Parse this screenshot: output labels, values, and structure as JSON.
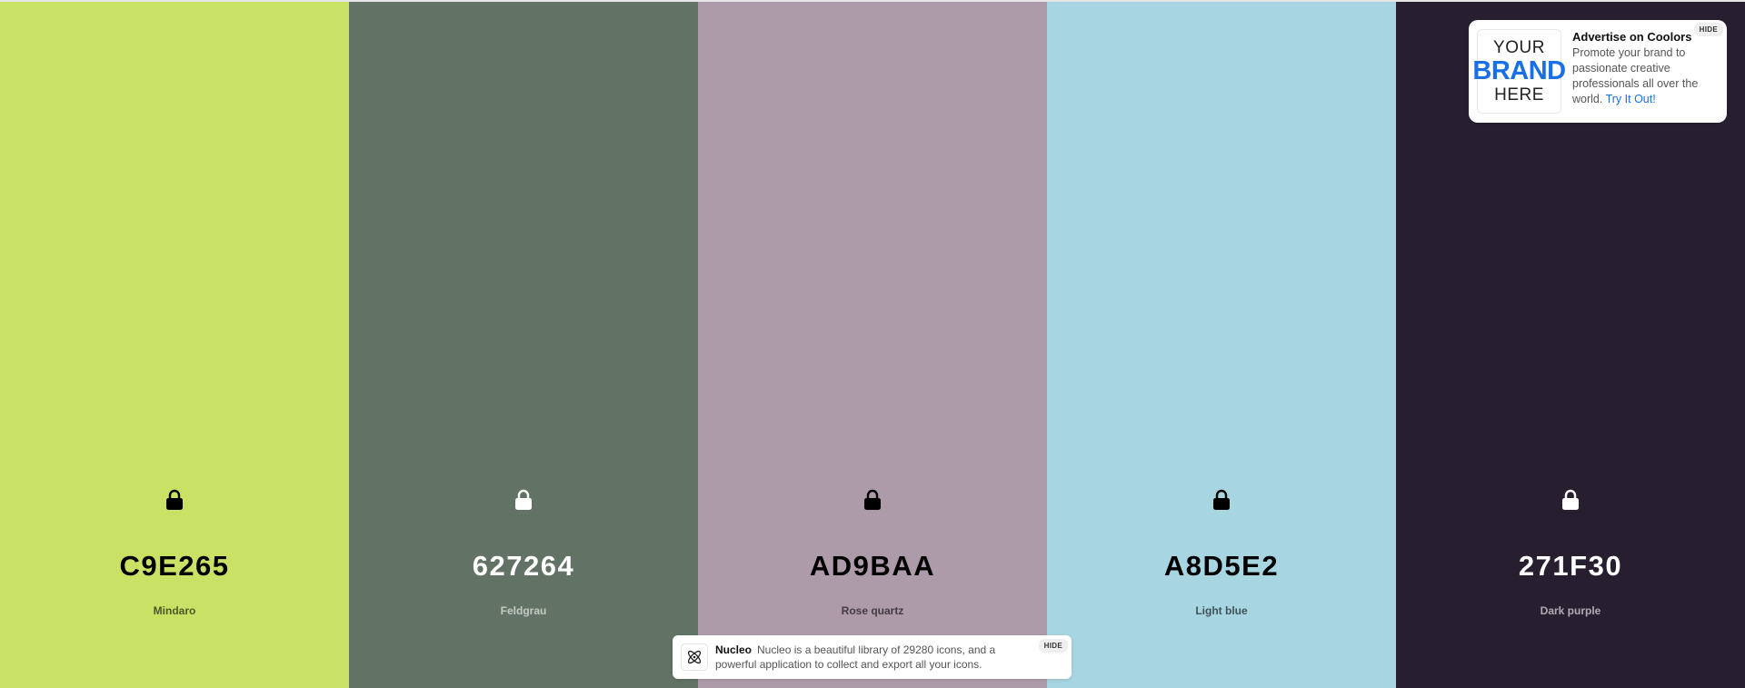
{
  "palette": {
    "colors": [
      {
        "hex": "C9E265",
        "name": "Mindaro",
        "bg": "#C9E265",
        "text_tone": "dark"
      },
      {
        "hex": "627264",
        "name": "Feldgrau",
        "bg": "#627264",
        "text_tone": "light"
      },
      {
        "hex": "AD9BAA",
        "name": "Rose quartz",
        "bg": "#AD9BAA",
        "text_tone": "dark"
      },
      {
        "hex": "A8D5E2",
        "name": "Light blue",
        "bg": "#A8D5E2",
        "text_tone": "dark"
      },
      {
        "hex": "271F30",
        "name": "Dark purple",
        "bg": "#271F30",
        "text_tone": "light"
      }
    ],
    "lock_icon": "lock-icon"
  },
  "ad": {
    "logo_line1": "YOUR",
    "logo_line2": "BRAND",
    "logo_line3": "HERE",
    "title": "Advertise on Coolors",
    "body": "Promote your brand to passionate creative professionals all over the world.",
    "link": "Try It Out!",
    "hide_label": "HIDE",
    "accent_color": "#1a6fe6"
  },
  "notification": {
    "icon": "nucleo-atom-icon",
    "title": "Nucleo",
    "body": "Nucleo is a beautiful library of 29280 icons, and a powerful application to collect and export all your icons.",
    "hide_label": "HIDE"
  }
}
